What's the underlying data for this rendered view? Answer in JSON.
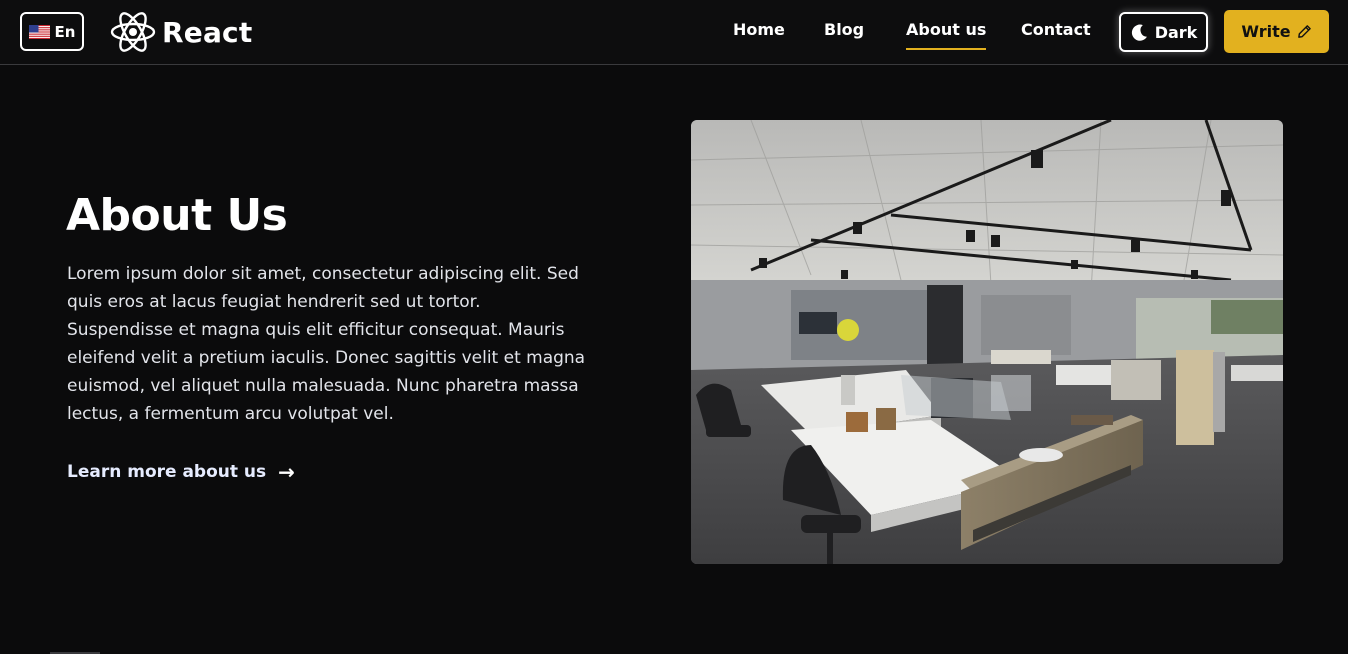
{
  "header": {
    "language": {
      "label": "En",
      "flag_icon": "us-flag-icon"
    },
    "brand": {
      "name": "React",
      "icon": "react-atom-icon"
    },
    "nav": [
      {
        "label": "Home",
        "active": false
      },
      {
        "label": "Blog",
        "active": false
      },
      {
        "label": "About us",
        "active": true
      },
      {
        "label": "Contact",
        "active": false
      }
    ],
    "theme_toggle": {
      "label": "Dark",
      "icon": "moon-icon"
    },
    "write_button": {
      "label": "Write",
      "icon": "pencil-icon"
    }
  },
  "hero": {
    "title": "About Us",
    "body": "Lorem ipsum dolor sit amet, consectetur adipiscing elit. Sed quis eros at lacus feugiat hendrerit sed ut tortor. Suspendisse et magna quis elit efficitur consequat. Mauris eleifend velit a pretium iaculis. Donec sagittis velit et magna euismod, vel aliquet nulla malesuada. Nunc pharetra massa lectus, a fermentum arcu volutpat vel.",
    "link_label": "Learn more about us",
    "link_icon": "arrow-right-icon"
  },
  "colors": {
    "background": "#0b0b0c",
    "accent": "#e2b11f",
    "text": "#ffffff"
  }
}
